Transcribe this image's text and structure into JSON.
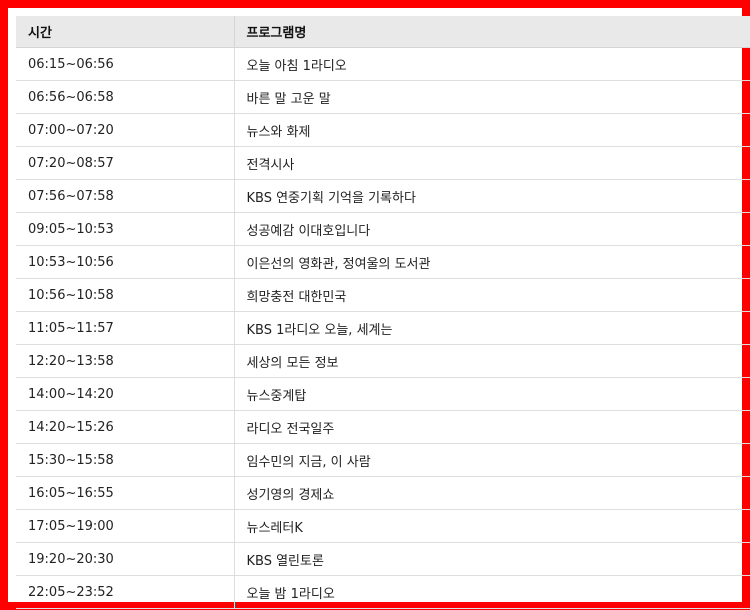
{
  "table": {
    "headers": {
      "time": "시간",
      "program": "프로그램명"
    },
    "rows": [
      {
        "time": "06:15~06:56",
        "program": "오늘 아침 1라디오"
      },
      {
        "time": "06:56~06:58",
        "program": "바른 말 고운 말"
      },
      {
        "time": "07:00~07:20",
        "program": "뉴스와 화제"
      },
      {
        "time": "07:20~08:57",
        "program": "전격시사"
      },
      {
        "time": "07:56~07:58",
        "program": "KBS 연중기획 기억을 기록하다"
      },
      {
        "time": "09:05~10:53",
        "program": "성공예감 이대호입니다"
      },
      {
        "time": "10:53~10:56",
        "program": "이은선의 영화관, 정여울의 도서관"
      },
      {
        "time": "10:56~10:58",
        "program": "희망충전 대한민국"
      },
      {
        "time": "11:05~11:57",
        "program": "KBS 1라디오 오늘, 세계는"
      },
      {
        "time": "12:20~13:58",
        "program": "세상의 모든 정보"
      },
      {
        "time": "14:00~14:20",
        "program": "뉴스중계탑"
      },
      {
        "time": "14:20~15:26",
        "program": "라디오 전국일주"
      },
      {
        "time": "15:30~15:58",
        "program": "임수민의 지금, 이 사람"
      },
      {
        "time": "16:05~16:55",
        "program": "성기영의 경제쇼"
      },
      {
        "time": "17:05~19:00",
        "program": "뉴스레터K"
      },
      {
        "time": "19:20~20:30",
        "program": "KBS 열린토론"
      },
      {
        "time": "22:05~23:52",
        "program": "오늘 밤 1라디오"
      }
    ]
  },
  "colors": {
    "frame": "#ff0000",
    "header_bg": "#e9e9e9"
  }
}
